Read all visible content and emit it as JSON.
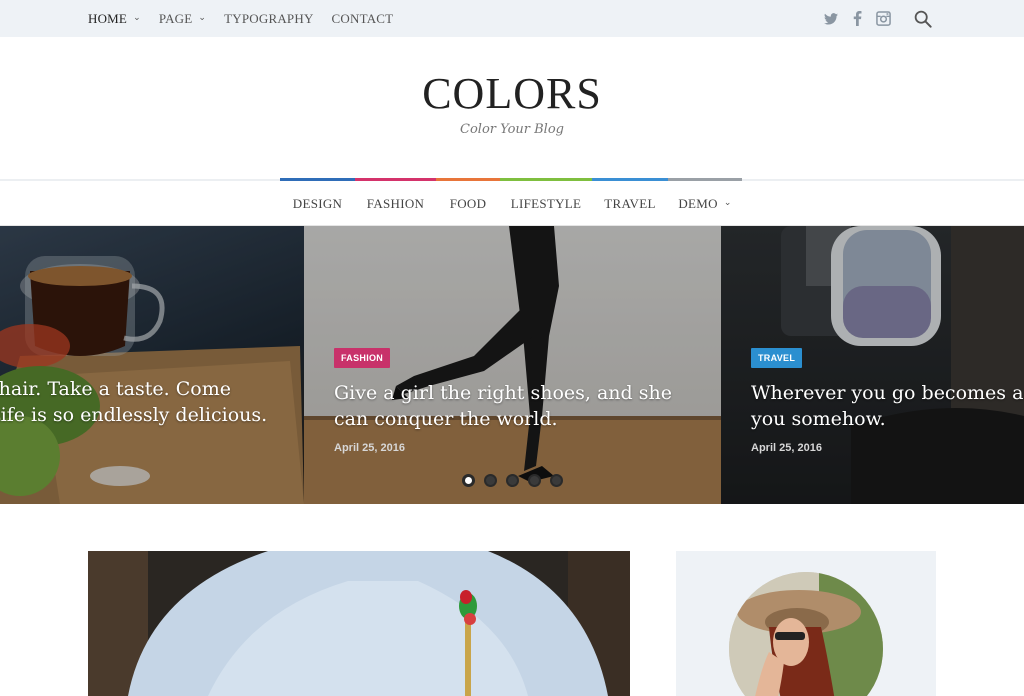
{
  "topnav": {
    "items": [
      {
        "label": "HOME",
        "has_dropdown": true
      },
      {
        "label": "PAGE",
        "has_dropdown": true
      },
      {
        "label": "TYPOGRAPHY",
        "has_dropdown": false
      },
      {
        "label": "CONTACT",
        "has_dropdown": false
      }
    ],
    "social_icons": [
      "twitter-icon",
      "facebook-icon",
      "instagram-icon"
    ],
    "search_icon": "search-icon"
  },
  "brand": {
    "title": "COLORS",
    "tagline": "Color Your Blog"
  },
  "mainnav": {
    "categories": [
      {
        "label": "DESIGN",
        "color": "#2f6db8"
      },
      {
        "label": "FASHION",
        "color": "#d4336b"
      },
      {
        "label": "FOOD",
        "color": "#e8753a"
      },
      {
        "label": "LIFESTYLE",
        "color": "#7fbf3f"
      },
      {
        "label": "TRAVEL",
        "color": "#3a8fd4"
      },
      {
        "label": "DEMO",
        "color": "#9aa0a6"
      }
    ],
    "demo_dropdown": true
  },
  "slider": {
    "slides": [
      {
        "category": "",
        "title_line1": "chair. Take a taste. Come",
        "title_line2": "Life is so endlessly delicious.",
        "date": ""
      },
      {
        "category": "FASHION",
        "category_color": "#c8326a",
        "title_line1": "Give a girl the right shoes, and she",
        "title_line2": "can conquer the world.",
        "date": "April 25, 2016"
      },
      {
        "category": "TRAVEL",
        "category_color": "#2b8fd0",
        "title_line1": "Wherever you go becomes a",
        "title_line2": "you somehow.",
        "date": "April 25, 2016"
      }
    ],
    "active_dot": 1,
    "dot_count": 5
  }
}
